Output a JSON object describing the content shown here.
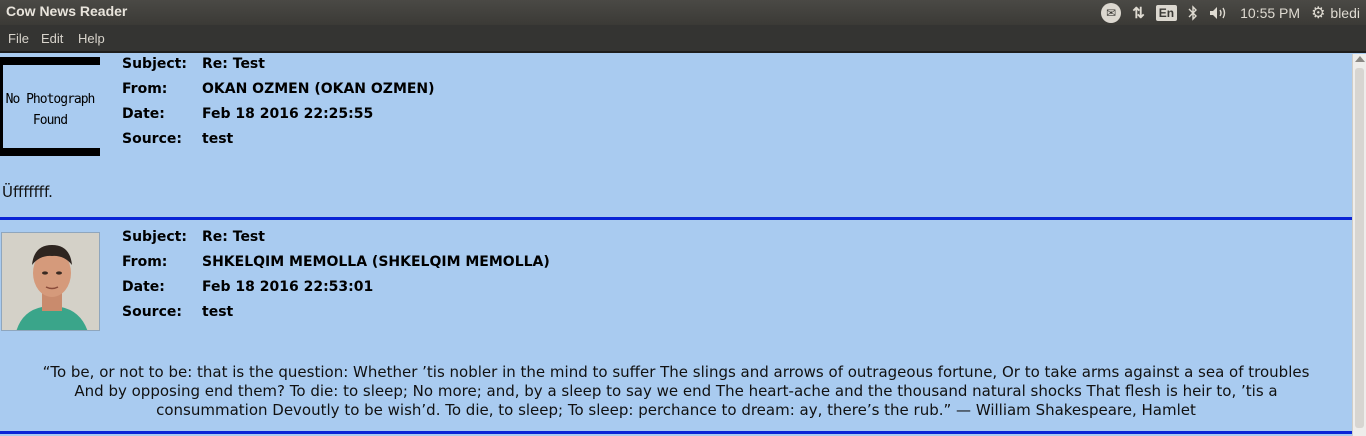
{
  "topbar": {
    "app_title": "Cow News Reader",
    "input_lang": "En",
    "time": "10:55 PM",
    "user": "bledi"
  },
  "menu": [
    "File",
    "Edit",
    "Help"
  ],
  "posts": [
    {
      "photo_missing_text": [
        "No Photograph",
        "Found"
      ],
      "fields": [
        {
          "label": "Subject:",
          "value": "Re: Test"
        },
        {
          "label": "From:",
          "value": "OKAN OZMEN (OKAN OZMEN)"
        },
        {
          "label": "Date:",
          "value": "Feb 18 2016 22:25:55"
        },
        {
          "label": "Source:",
          "value": "test"
        }
      ],
      "body": "Üfffffff."
    },
    {
      "fields": [
        {
          "label": "Subject:",
          "value": "Re: Test"
        },
        {
          "label": "From:",
          "value": "SHKELQIM MEMOLLA (SHKELQIM MEMOLLA)"
        },
        {
          "label": "Date:",
          "value": "Feb 18 2016 22:53:01"
        },
        {
          "label": "Source:",
          "value": "test"
        }
      ],
      "body_lines": [
        "“To be, or not to be: that is the question: Whether ’tis nobler in the mind to suffer The slings and arrows of outrageous fortune, Or to take arms against a sea of troubles",
        "And by opposing end them? To die: to sleep; No more; and, by a sleep to say we end The heart-ache and the thousand natural shocks That flesh is heir to, ’tis a",
        "consummation Devoutly to be wish’d. To die, to sleep; To sleep: perchance to dream: ay, there’s the rub.” — William Shakespeare, Hamlet"
      ]
    }
  ],
  "colors": {
    "background": "#a9cbf0",
    "separator": "#0a24d6",
    "panel": "#3b3a36"
  },
  "icons": [
    "mail-icon",
    "network-icon",
    "bluetooth-icon",
    "volume-icon",
    "power-gear-icon"
  ]
}
